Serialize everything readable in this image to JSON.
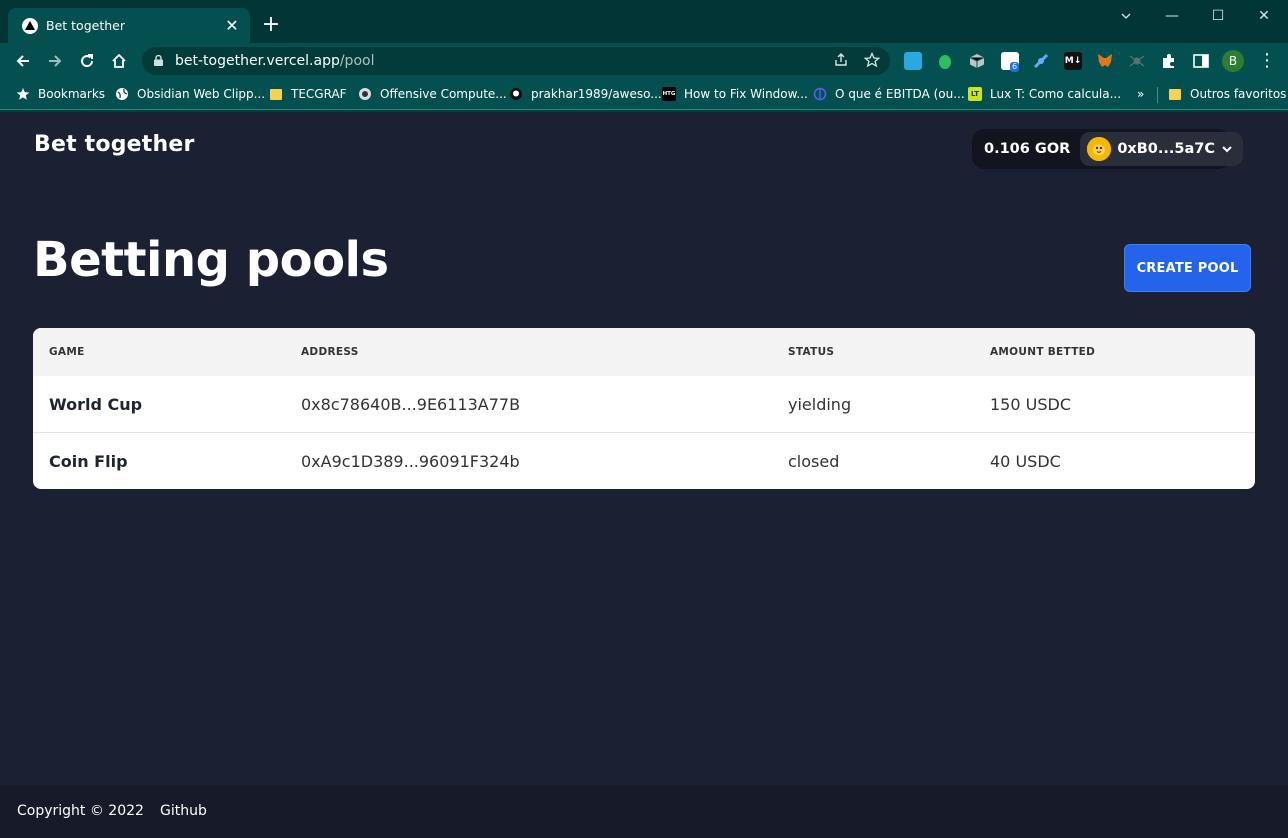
{
  "browser": {
    "tab_title": "Bet together",
    "tab_close": "✕",
    "new_tab": "+",
    "window_controls": {
      "minimize": "—",
      "maximize": "☐",
      "close": "✕"
    },
    "url_host": "bet-together.vercel.app",
    "url_path": "/pool",
    "extension_badge": "6",
    "extension_md": "M↓",
    "profile_initial": "B",
    "bookmarks": [
      {
        "label": "Bookmarks",
        "icon": "star-icon"
      },
      {
        "label": "Obsidian Web Clipp...",
        "icon": "globe-icon"
      },
      {
        "label": "TECGRAF",
        "icon": "folder-icon"
      },
      {
        "label": "Offensive Compute...",
        "icon": "site-icon"
      },
      {
        "label": "prakhar1989/aweso...",
        "icon": "github-icon"
      },
      {
        "label": "How to Fix Window...",
        "icon": "htg-icon"
      },
      {
        "label": "O que é EBITDA (ou...",
        "icon": "site-icon"
      },
      {
        "label": "Lux T: Como calcula...",
        "icon": "lt-icon"
      }
    ],
    "overflow": "»",
    "other_bookmarks": "Outros favoritos",
    "htg_icon_text": "HTG",
    "lt_icon_text": "LT"
  },
  "app": {
    "brand": "Bet together",
    "wallet": {
      "balance": "0.106 GOR",
      "address": "0xB0...5a7C"
    },
    "page_title": "Betting pools",
    "create_button": "CREATE POOL",
    "table": {
      "headers": [
        "GAME",
        "ADDRESS",
        "STATUS",
        "AMOUNT BETTED"
      ],
      "rows": [
        {
          "game": "World Cup",
          "address": "0x8c78640B...9E6113A77B",
          "status": "yielding",
          "amount": "150 USDC"
        },
        {
          "game": "Coin Flip",
          "address": "0xA9c1D389...96091F324b",
          "status": "closed",
          "amount": "40 USDC"
        }
      ]
    },
    "footer": {
      "copyright": "Copyright © 2022",
      "github": "Github"
    }
  },
  "colors": {
    "page_bg": "#1c2033",
    "primary_button": "#2563eb",
    "chrome_teal": "#045050"
  }
}
